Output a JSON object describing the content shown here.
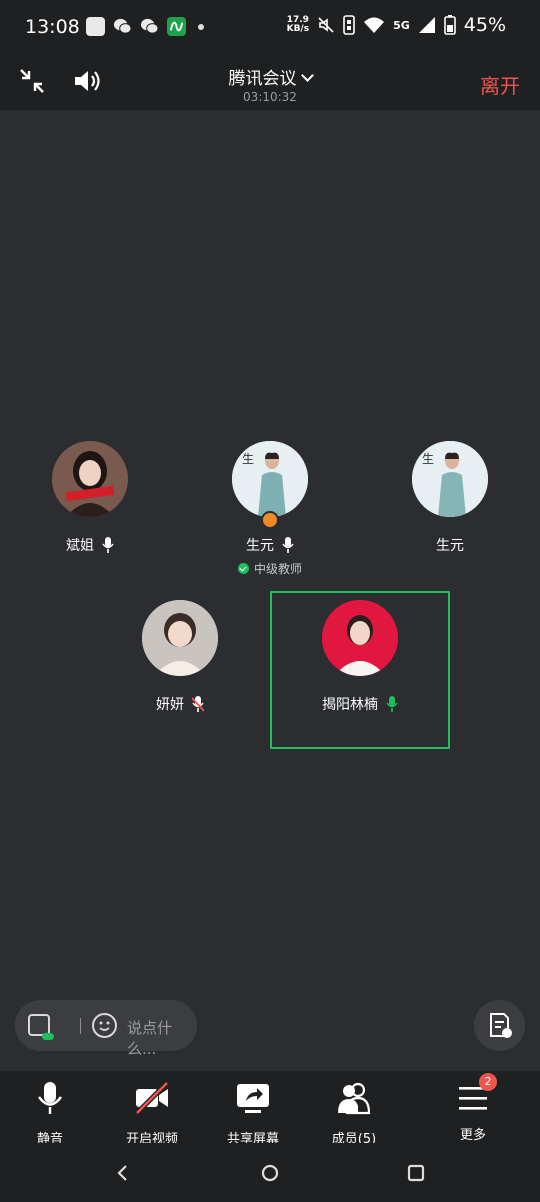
{
  "status_bar": {
    "time": "13:08",
    "net_speed_value": "17.9",
    "net_speed_unit": "KB/s",
    "network": "5G",
    "battery": "45%"
  },
  "header": {
    "title": "腾讯会议",
    "duration": "03:10:32",
    "leave_label": "离开"
  },
  "participants": [
    {
      "name": "斌姐",
      "mic": "on"
    },
    {
      "name": "生元",
      "mic": "on",
      "role": "中级教师",
      "host": true
    },
    {
      "name": "生元",
      "mic": "none"
    },
    {
      "name": "妍妍",
      "mic": "muted"
    },
    {
      "name": "揭阳林楠",
      "mic": "speaking"
    }
  ],
  "chat": {
    "placeholder": "说点什么..."
  },
  "toolbar": {
    "mute_label": "静音",
    "video_label": "开启视频",
    "share_label": "共享屏幕",
    "members_label": "成员(5)",
    "more_label": "更多",
    "more_badge": "2"
  },
  "colors": {
    "accent_green": "#1fbf5c",
    "leave_red": "#f0554d",
    "background": "#2b2d30"
  }
}
